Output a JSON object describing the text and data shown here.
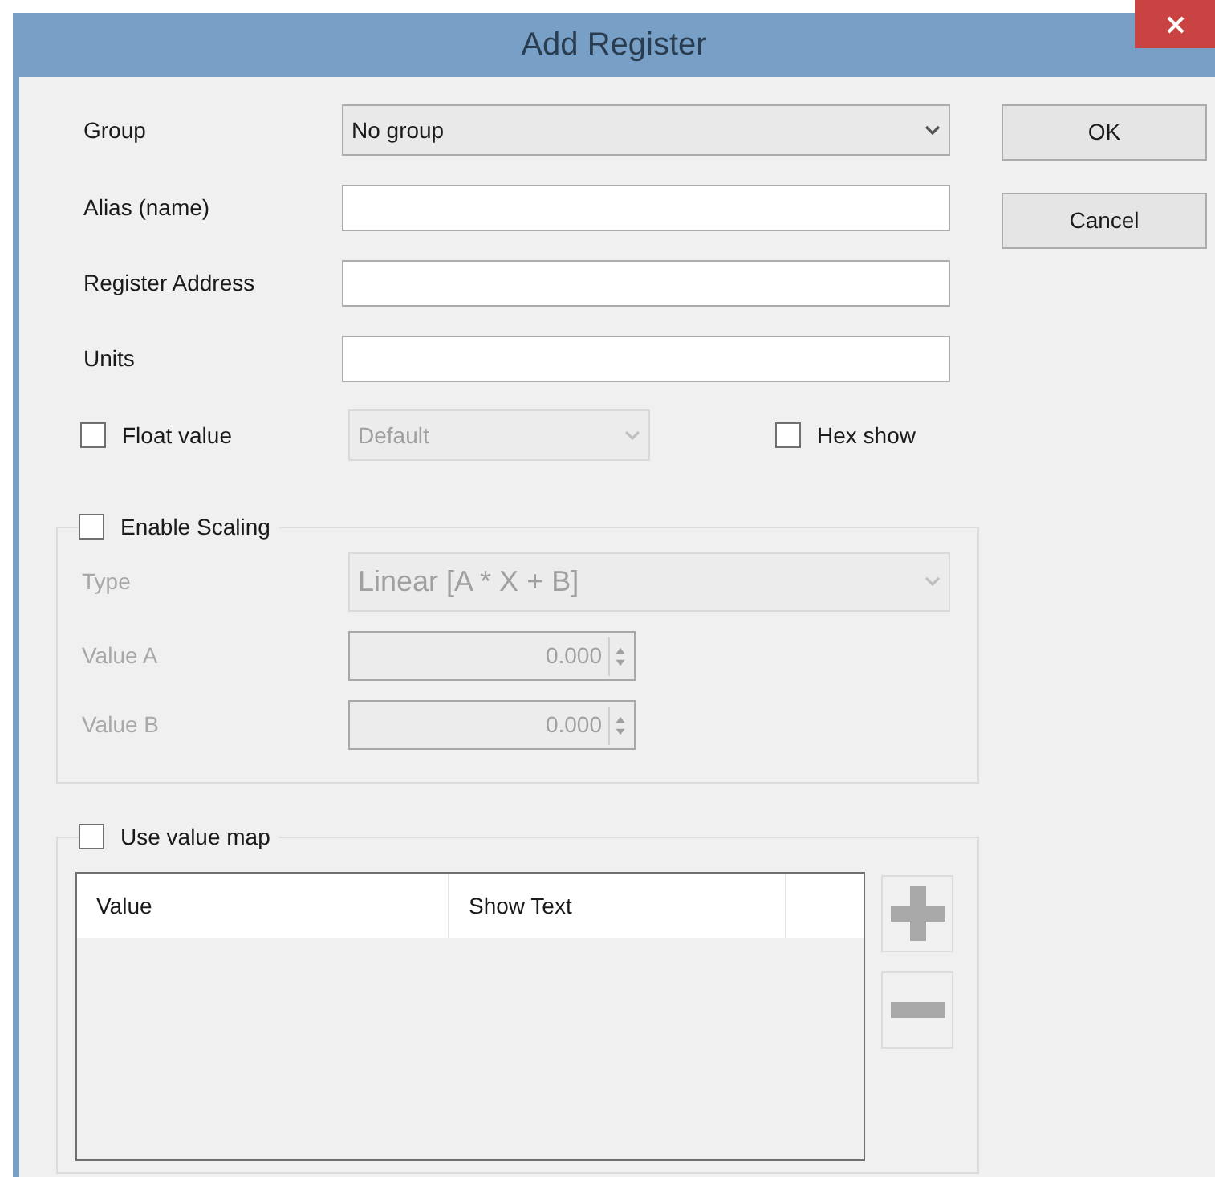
{
  "window": {
    "title": "Add Register"
  },
  "fields": [
    {
      "label": "Group",
      "kind": "dropdown",
      "value": "No group"
    },
    {
      "label": "Alias (name)",
      "kind": "text"
    },
    {
      "label": "Register Address",
      "kind": "text"
    },
    {
      "label": "Units",
      "kind": "text"
    }
  ],
  "float_value": {
    "label": "Float value",
    "checked": false,
    "format": {
      "value": "Default",
      "disabled": true
    }
  },
  "hex_show": {
    "label": "Hex show",
    "checked": false
  },
  "scaling": {
    "label": "Enable Scaling",
    "checked": false,
    "rows": [
      {
        "kind": "dropdown",
        "label": "Type",
        "value": "Linear [A * X + B]",
        "disabled": true
      },
      {
        "kind": "spinner",
        "label": "Value A",
        "value": "0.000",
        "disabled": true
      },
      {
        "kind": "spinner",
        "label": "Value B",
        "value": "0.000",
        "disabled": true
      }
    ]
  },
  "value_map": {
    "label": "Use value map",
    "checked": false,
    "columns": [
      "Value",
      "Show Text"
    ],
    "add_button": {
      "disabled": true
    },
    "remove_button": {
      "disabled": true
    }
  },
  "buttons": [
    {
      "label": "OK"
    },
    {
      "label": "Cancel"
    }
  ]
}
